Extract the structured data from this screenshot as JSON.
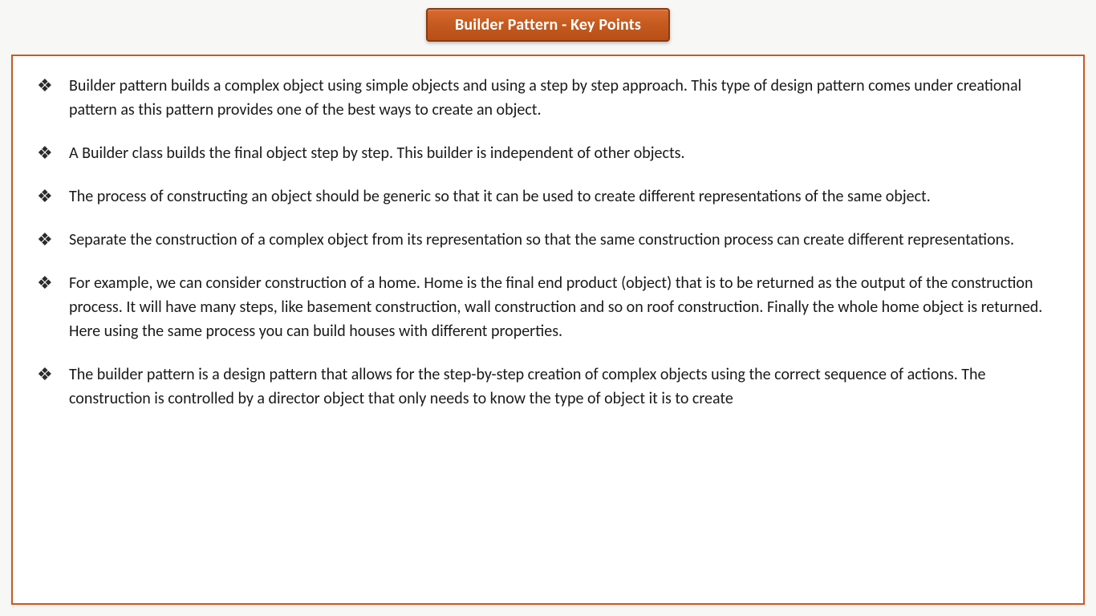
{
  "title": "Builder Pattern - Key Points",
  "points": [
    "Builder pattern builds a complex object using simple objects and using a step by step approach. This type of design pattern comes under creational pattern as this pattern provides one of the best ways to create an object.",
    "A Builder class builds the final object step by step. This builder is independent of other objects.",
    "The process of constructing an object should be generic so that it can be used to create different representations of the same object.",
    "Separate the construction of a complex object from its representation so that the same construction process can create different representations.",
    "For example, we can consider construction of a home. Home is the final end product (object) that is to be returned as the output of the construction process. It will have many steps, like basement construction, wall construction and so on roof construction. Finally the whole home object is returned. Here using the same process you can build houses with different properties.",
    "The builder pattern is a design pattern that allows for the step-by-step creation of complex objects using the correct sequence of actions. The construction is controlled by a director object that only needs to know the type of object it is to create"
  ]
}
